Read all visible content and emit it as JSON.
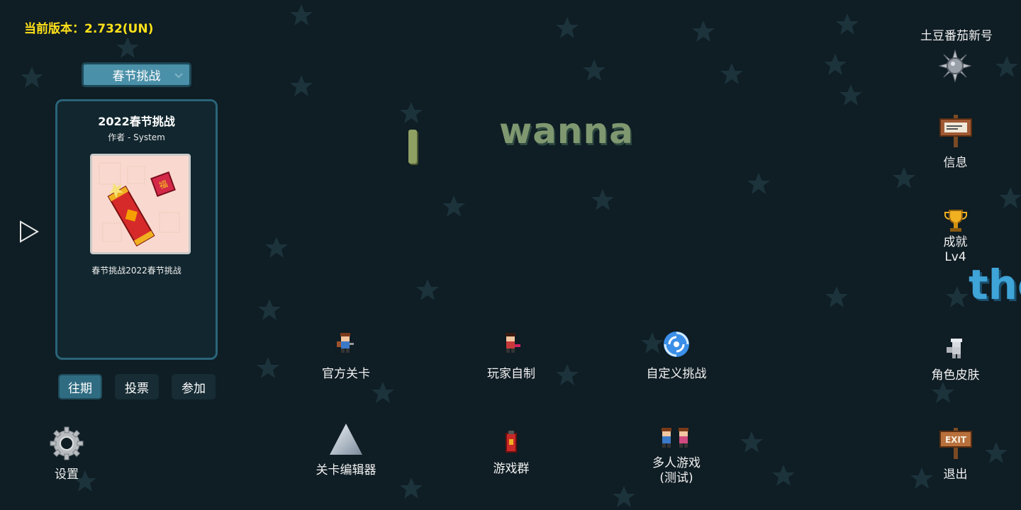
{
  "header": {
    "version": "当前版本：2.732(UN)",
    "username": "土豆番茄新号"
  },
  "challenge": {
    "dropdown_selected": "春节挑战",
    "title": "2022春节挑战",
    "author": "作者 - System",
    "description": "春节挑战2022春节挑战"
  },
  "tabs": [
    {
      "label": "往期",
      "active": true
    },
    {
      "label": "投票",
      "active": false
    },
    {
      "label": "参加",
      "active": false
    }
  ],
  "game_title": {
    "word1": "I",
    "word2": "wanna",
    "word3": "the"
  },
  "menu": {
    "official_levels": "官方关卡",
    "player_made": "玩家自制",
    "custom_challenge": "自定义挑战",
    "level_editor": "关卡编辑器",
    "game_group": "游戏群",
    "multiplayer_line1": "多人游戏",
    "multiplayer_line2": "(测试)",
    "settings": "设置"
  },
  "right_menu": {
    "info": "信息",
    "achievements": "成就",
    "achievement_level": "Lv4",
    "skins": "角色皮肤",
    "exit": "退出",
    "exit_sign": "EXIT"
  },
  "colors": {
    "background": "#0f1d24",
    "version_text": "#ffe11a",
    "panel_border": "#2a6478",
    "active_tab": "#2f6c82"
  }
}
